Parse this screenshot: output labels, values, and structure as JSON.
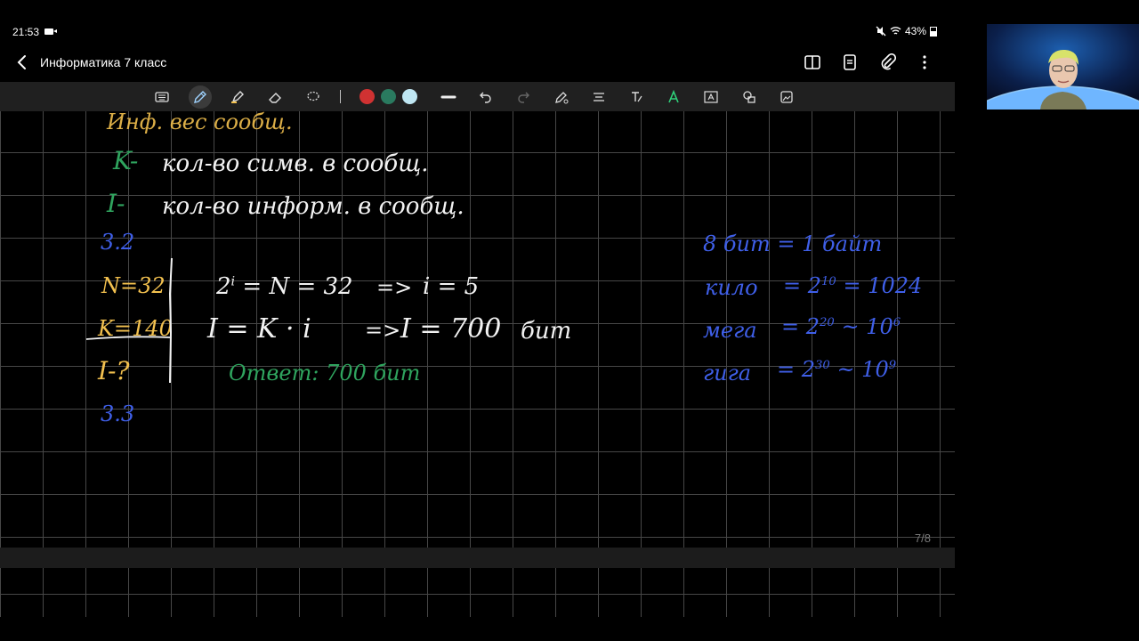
{
  "status_bar": {
    "time": "21:53",
    "battery": "43%"
  },
  "header": {
    "title": "Информатика 7 класс"
  },
  "toolbar": {
    "colors": [
      "#d03232",
      "#2a7a5f",
      "#bfe6f2"
    ]
  },
  "canvas": {
    "line1": "Инф. вес сообщ.",
    "line2_letter": "K-",
    "line2_text": "кол-во симв. в сообщ.",
    "line3_letter": "I-",
    "line3_text": "кол-во информ. в сообщ.",
    "task_32": "3.2",
    "given_n": "N=32",
    "given_k": "K=140",
    "given_i": "I-?",
    "eq1_base": "2",
    "eq1_exp": "i",
    "eq1_rest": "= N = 32",
    "eq1_arrow": "=>",
    "eq1_result": "i = 5",
    "eq2_left": "I = K · i",
    "eq2_arrow": "=>",
    "eq2_result": "I = 700",
    "eq2_unit": "бит",
    "answer": "Ответ: 700 бит",
    "task_33": "3.3",
    "ref_byte": "8 бит = 1 байт",
    "ref_kilo_label": "кило",
    "ref_kilo_eq": "= 2",
    "ref_kilo_exp": "10",
    "ref_kilo_val": "= 1024",
    "ref_mega_label": "мега",
    "ref_mega_eq": "= 2",
    "ref_mega_exp": "20",
    "ref_mega_approx": "~ 10",
    "ref_mega_exp2": "6",
    "ref_giga_label": "гига",
    "ref_giga_eq": "= 2",
    "ref_giga_exp": "30",
    "ref_giga_approx": "~ 10",
    "ref_giga_exp2": "9"
  },
  "page_counter": "7/8"
}
